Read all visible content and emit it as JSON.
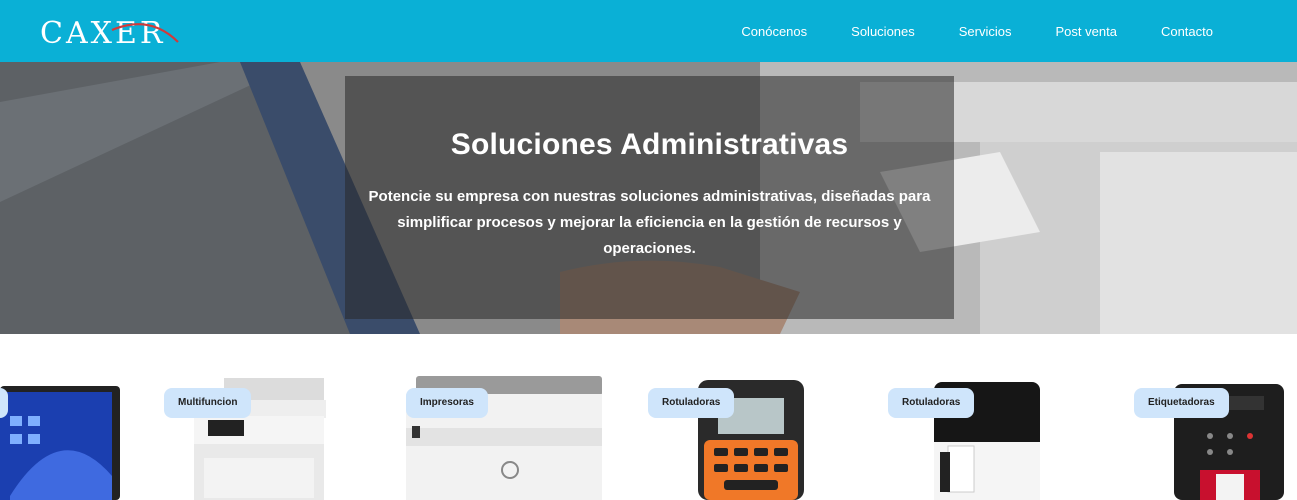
{
  "header": {
    "logo": "CAXER",
    "nav": [
      "Conócenos",
      "Soluciones",
      "Servicios",
      "Post venta",
      "Contacto"
    ]
  },
  "hero": {
    "title": "Soluciones Administrativas",
    "text": "Potencie su empresa con nuestras soluciones administrativas, diseñadas para simplificar procesos y mejorar la eficiencia en la gestión de recursos y operaciones."
  },
  "products": [
    {
      "label": "",
      "icon": "laptop-icon"
    },
    {
      "label": "Multifuncion",
      "icon": "multifunction-printer-icon"
    },
    {
      "label": "Impresoras",
      "icon": "printer-icon"
    },
    {
      "label": "Rotuladoras",
      "icon": "label-maker-icon"
    },
    {
      "label": "Rotuladoras",
      "icon": "label-printer-icon"
    },
    {
      "label": "Etiquetadoras",
      "icon": "label-printer-icon"
    }
  ],
  "colors": {
    "header": "#0ab0d6",
    "pill": "#cfe5fb"
  }
}
